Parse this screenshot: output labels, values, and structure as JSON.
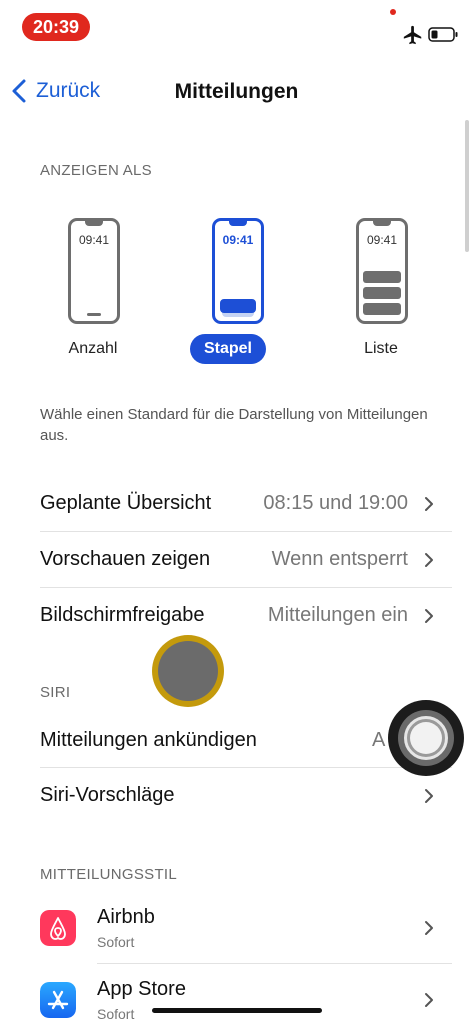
{
  "status": {
    "time": "20:39",
    "icons": [
      "recording-dot-icon",
      "airplane-icon",
      "battery-icon"
    ]
  },
  "nav": {
    "back_label": "Zurück",
    "title": "Mitteilungen"
  },
  "display_as": {
    "header": "ANZEIGEN ALS",
    "options": [
      {
        "label": "Anzahl",
        "phone_time": "09:41",
        "selected": false
      },
      {
        "label": "Stapel",
        "phone_time": "09:41",
        "selected": true
      },
      {
        "label": "Liste",
        "phone_time": "09:41",
        "selected": false
      }
    ],
    "description": "Wähle einen Standard für die Darstellung von Mitteilungen aus."
  },
  "settings_rows": [
    {
      "label": "Geplante Übersicht",
      "value": "08:15 und 19:00"
    },
    {
      "label": "Vorschauen zeigen",
      "value": "Wenn entsperrt"
    },
    {
      "label": "Bildschirmfreigabe",
      "value": "Mitteilungen ein"
    }
  ],
  "siri": {
    "header": "SIRI",
    "rows": [
      {
        "label": "Mitteilungen ankündigen",
        "value": "A"
      },
      {
        "label": "Siri-Vorschläge",
        "value": ""
      }
    ]
  },
  "style": {
    "header": "MITTEILUNGSSTIL",
    "apps": [
      {
        "name": "Airbnb",
        "sub": "Sofort",
        "icon": "airbnb-icon",
        "color": "#ff385c"
      },
      {
        "name": "App Store",
        "sub": "Sofort",
        "icon": "app-store-icon",
        "color": "#1a8cff"
      }
    ]
  },
  "colors": {
    "accent": "#1d4fd6",
    "status_red": "#e0281e"
  }
}
